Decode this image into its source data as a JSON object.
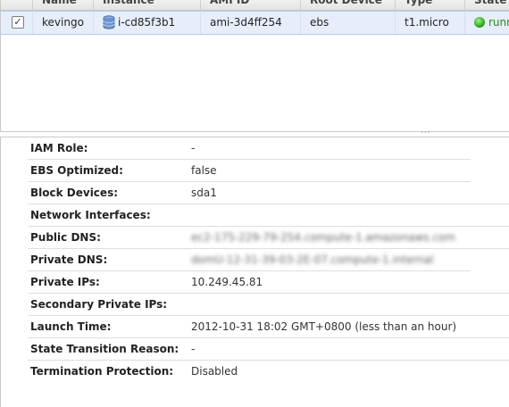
{
  "grid": {
    "columns": [
      {
        "key": "name",
        "label": "Name"
      },
      {
        "key": "instance",
        "label": "Instance"
      },
      {
        "key": "ami",
        "label": "AMI ID"
      },
      {
        "key": "root",
        "label": "Root Device"
      },
      {
        "key": "type",
        "label": "Type"
      },
      {
        "key": "state",
        "label": "State"
      }
    ],
    "row": {
      "checked": true,
      "check_mark": "✓",
      "name": "kevingo",
      "instance_icon": "ebs-volume-icon",
      "instance": "i-cd85f3b1",
      "ami": "ami-3d4ff254",
      "root": "ebs",
      "type": "t1.micro",
      "state": "runn",
      "state_color": "#2fa81b"
    },
    "splitter_grip": "..."
  },
  "details": [
    {
      "label": "IAM Role:",
      "value": "-"
    },
    {
      "label": "EBS Optimized:",
      "value": "false"
    },
    {
      "label": "Block Devices:",
      "value": "sda1"
    },
    {
      "label": "Network Interfaces:",
      "value": ""
    },
    {
      "label": "Public DNS:",
      "value": "ec2-175-229-79-254.compute-1.amazonaws.com"
    },
    {
      "label": "Private DNS:",
      "value": "domU-12-31-39-03-2E-07.compute-1.internal"
    },
    {
      "label": "Private IPs:",
      "value": "10.249.45.81"
    },
    {
      "label": "Secondary Private IPs:",
      "value": ""
    },
    {
      "label": "Launch Time:",
      "value": "2012-10-31 18:02 GMT+0800 (less than an hour)"
    },
    {
      "label": "State Transition Reason:",
      "value": "-"
    },
    {
      "label": "Termination Protection:",
      "value": "Disabled"
    }
  ],
  "colors": {
    "selection": "#e6eefb",
    "link": "#1d4fa0",
    "running": "#2fa81b"
  }
}
